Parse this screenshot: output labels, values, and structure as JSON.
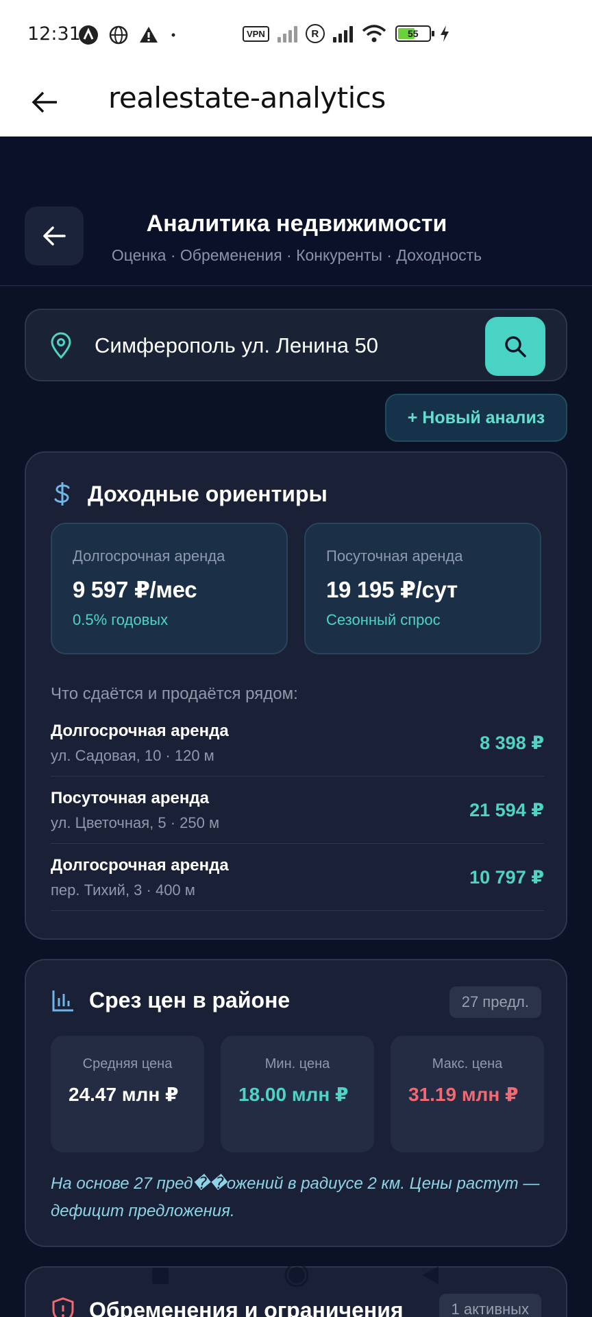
{
  "status_bar": {
    "time": "12:31",
    "vpn": "VPN",
    "roaming": "R",
    "battery": "55"
  },
  "app_bar": {
    "title": "realestate-analytics"
  },
  "header": {
    "title": "Аналитика недвижимости",
    "subtitle": "Оценка · Обременения · Конкуренты · Доходность"
  },
  "search": {
    "value": "Симферополь ул. Ленина 50"
  },
  "new_analysis_label": "+ Новый анализ",
  "income": {
    "title": "Доходные ориентиры",
    "boxes": [
      {
        "label": "Долгосрочная аренда",
        "value": "9 597 ₽/мес",
        "sub": "0.5% годовых"
      },
      {
        "label": "Посуточная аренда",
        "value": "19 195 ₽/сут",
        "sub": "Сезонный спрос"
      }
    ],
    "nearby_caption": "Что сдаётся и продаётся рядом:",
    "nearby": [
      {
        "type": "Долгосрочная аренда",
        "address": "ул. Садовая, 10 · 120 м",
        "price": "8 398 ₽"
      },
      {
        "type": "Посуточная аренда",
        "address": "ул. Цветочная, 5 · 250 м",
        "price": "21 594 ₽"
      },
      {
        "type": "Долгосрочная аренда",
        "address": "пер. Тихий, 3 · 400 м",
        "price": "10 797 ₽"
      }
    ]
  },
  "prices": {
    "title": "Срез цен в районе",
    "badge": "27 предл.",
    "stats": [
      {
        "label": "Средняя цена",
        "value": "24.47 млн ₽",
        "color": "#ffffff"
      },
      {
        "label": "Мин. цена",
        "value": "18.00 млн ₽",
        "color": "#4fd4c3"
      },
      {
        "label": "Макс. цена",
        "value": "31.19 млн ₽",
        "color": "#f06a74"
      }
    ],
    "note": "На основе 27 пред��ожений в радиусе 2 км. Цены растут — дефицит предложения."
  },
  "encumbrances": {
    "title": "Обременения и ограничения",
    "badge": "1 активных"
  },
  "colors": {
    "accent": "#49d3c4",
    "background": "#0b1226",
    "card": "#1a2136",
    "danger": "#f06a74"
  }
}
